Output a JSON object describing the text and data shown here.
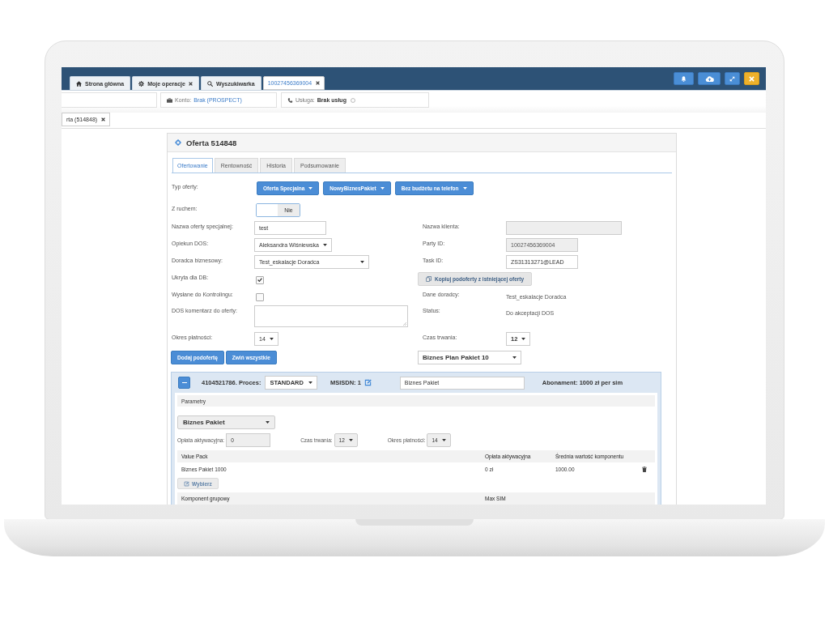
{
  "top_bar": {
    "tabs": [
      {
        "kind": "home",
        "label": "Strona główna",
        "closable": false,
        "selected": false
      },
      {
        "kind": "settings",
        "label": "Moje operacje",
        "closable": true,
        "selected": false
      },
      {
        "kind": "search",
        "label": "Wyszukiwarka",
        "closable": false,
        "selected": false
      },
      {
        "kind": "plain",
        "label": "10027456369004",
        "closable": true,
        "selected": true
      }
    ],
    "actions": [
      {
        "kind": "bell"
      },
      {
        "kind": "cloud-upload"
      },
      {
        "kind": "expand"
      },
      {
        "kind": "close"
      }
    ]
  },
  "info_bar": {
    "fields": [
      {
        "kind": "blank"
      },
      {
        "kind": "account",
        "label": "Konto:",
        "value": "Brak (PROSPECT)"
      },
      {
        "kind": "service",
        "label": "Usługa:",
        "value": "Brak usług"
      }
    ]
  },
  "subtabs": [
    {
      "label": "rta (514848)",
      "closable": true,
      "selected": true
    }
  ],
  "offer": {
    "title": "Oferta 514848",
    "tabs": [
      {
        "label": "Ofertowanie",
        "selected": true
      },
      {
        "label": "Rentowność",
        "selected": false
      },
      {
        "label": "Historia",
        "selected": false
      },
      {
        "label": "Podsumowanie",
        "selected": false
      }
    ],
    "form": [
      {
        "left": {
          "kind": "buttons",
          "label": "Typ oferty:",
          "buttons": [
            "Oferta Specjalna",
            "NowyBiznesPakiet",
            "Bez budżetu na telefon"
          ]
        }
      },
      {
        "left": {
          "kind": "toggle",
          "label": "Z ruchem:",
          "value": "Nie",
          "on": false
        }
      },
      {
        "left": {
          "kind": "input",
          "label": "Nazwa oferty specjalnej:",
          "value": "test",
          "disabled": false
        },
        "right": {
          "kind": "input",
          "label": "Nazwa klienta:",
          "disabled": true
        }
      },
      {
        "left": {
          "kind": "select",
          "label": "Opiekun DOS:",
          "value": "Aleksandra Wiśniewska"
        },
        "right": {
          "kind": "input",
          "label": "Party ID:",
          "value": "10027456369004",
          "disabled": true
        }
      },
      {
        "left": {
          "kind": "select",
          "label": "Doradca biznesowy:",
          "value": "Test_eskalacje Doradca"
        },
        "right": {
          "kind": "input",
          "label": "Task ID:",
          "value": "ZS31313271@LEAD",
          "disabled": false
        }
      },
      {
        "left": {
          "kind": "checkbox",
          "label": "Ukryta dla DB:",
          "checked": true
        },
        "right": {
          "kind": "button",
          "label": "Kopiuj podoferty z istniejącej oferty"
        }
      },
      {
        "left": {
          "kind": "checkbox",
          "label": "Wysłane do Kontrolingu:",
          "checked": false
        },
        "right": {
          "kind": "text",
          "label": "Dane doradcy:",
          "value": "Test_eskalacje Doradca"
        }
      },
      {
        "left": {
          "kind": "textarea",
          "label": "DOS komentarz do oferty:"
        },
        "right": {
          "kind": "text",
          "label": "Status:",
          "value": "Do akceptacji DOS"
        }
      },
      {
        "left": {
          "kind": "select",
          "label": "Okres płatności:",
          "value": "14"
        },
        "right": {
          "kind": "select",
          "label": "Czas trwania:",
          "value": "12"
        }
      },
      {
        "left": {
          "kind": "actions",
          "buttons": [
            "Dodaj podofertę",
            "Zwiń wszystkie"
          ]
        },
        "right": {
          "kind": "select",
          "value": "Biznes Plan Pakiet 10"
        }
      }
    ],
    "sub_offer": {
      "expanded": true,
      "heading": "4104521786. Proces:",
      "process": "STANDARD",
      "msisdn": "MSISDN: 1",
      "name": "Biznes Pakiet",
      "subscription": "Abonament: 1000 zł per sim",
      "parameters": {
        "title": "Parametry",
        "package": "Biznes Pakiet",
        "fields": [
          {
            "kind": "input",
            "label": "Opłata aktywacyjna:",
            "value": "0",
            "disabled": true
          },
          {
            "kind": "select",
            "label": "Czas trwania:",
            "value": "12"
          },
          {
            "kind": "select",
            "label": "Okres płatności:",
            "value": "14"
          }
        ]
      },
      "value_packs": {
        "columns": [
          "Value Pack",
          "Opłata aktywacyjna",
          "Średnia wartość komponentu"
        ],
        "rows": [
          [
            "Biznes Pakiet 1000",
            "0 zł",
            "1000.00"
          ]
        ]
      },
      "choose_button": "Wybierz",
      "group_components": {
        "columns": [
          "Komponent grupowy",
          "Max SIM"
        ]
      }
    }
  }
}
